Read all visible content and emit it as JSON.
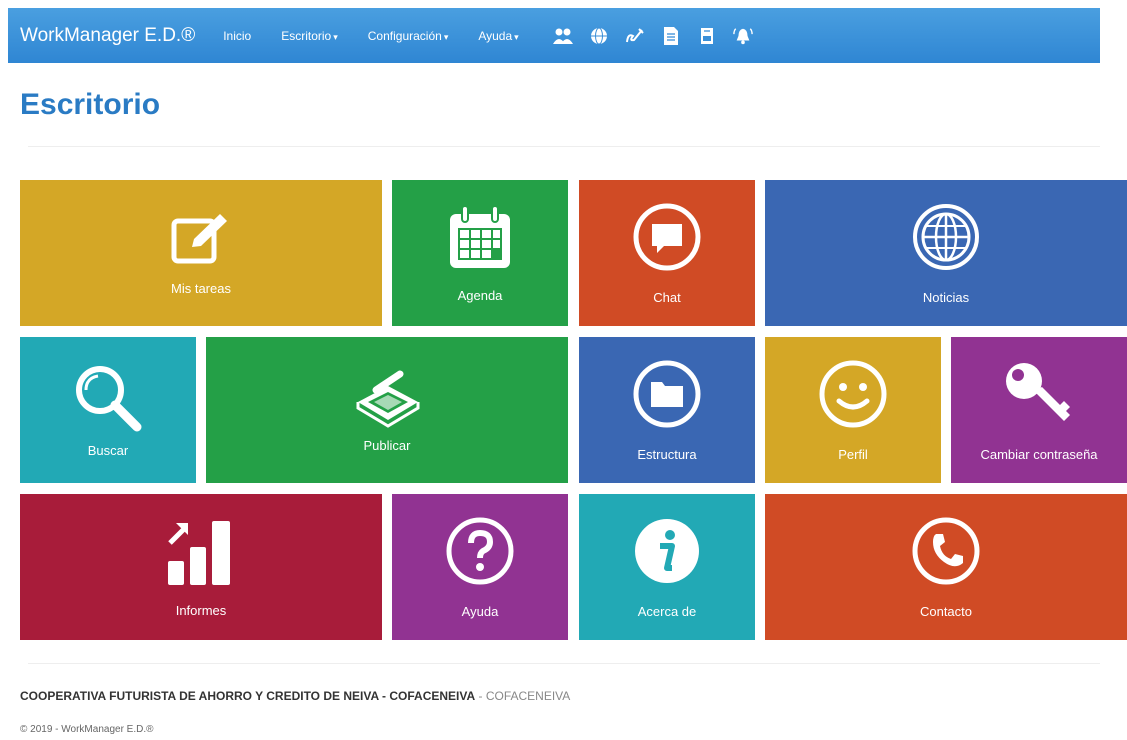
{
  "navbar": {
    "brand": "WorkManager E.D.®",
    "links": [
      "Inicio",
      "Escritorio",
      "Configuración",
      "Ayuda"
    ],
    "caret": "▾",
    "icons": [
      "users-icon",
      "globe-icon",
      "sign-icon",
      "document-icon",
      "archive-icon",
      "bell-icon"
    ]
  },
  "page": {
    "title": "Escritorio"
  },
  "tiles": [
    {
      "label": "Mis tareas",
      "icon": "edit-icon",
      "color": "#d4a726"
    },
    {
      "label": "Agenda",
      "icon": "calendar-icon",
      "color": "#24a047"
    },
    {
      "label": "Chat",
      "icon": "chat-icon",
      "color": "#d04b25"
    },
    {
      "label": "Noticias",
      "icon": "globe-icon",
      "color": "#3a67b3"
    },
    {
      "label": "Buscar",
      "icon": "search-icon",
      "color": "#22a9b5"
    },
    {
      "label": "Publicar",
      "icon": "scanner-icon",
      "color": "#24a047"
    },
    {
      "label": "Estructura",
      "icon": "folder-icon",
      "color": "#3a67b3"
    },
    {
      "label": "Perfil",
      "icon": "smiley-icon",
      "color": "#d4a726"
    },
    {
      "label": "Cambiar contraseña",
      "icon": "key-icon",
      "color": "#913392"
    },
    {
      "label": "Informes",
      "icon": "chart-icon",
      "color": "#a81c3a"
    },
    {
      "label": "Ayuda",
      "icon": "help-icon",
      "color": "#913392"
    },
    {
      "label": "Acerca de",
      "icon": "info-icon",
      "color": "#22a9b5"
    },
    {
      "label": "Contacto",
      "icon": "phone-icon",
      "color": "#d04b25"
    }
  ],
  "footer": {
    "org_name": "COOPERATIVA FUTURISTA DE AHORRO Y CREDITO DE NEIVA - COFACENEIVA",
    "org_short": " - COFACENEIVA",
    "copyright": "© 2019 - WorkManager E.D.®"
  }
}
